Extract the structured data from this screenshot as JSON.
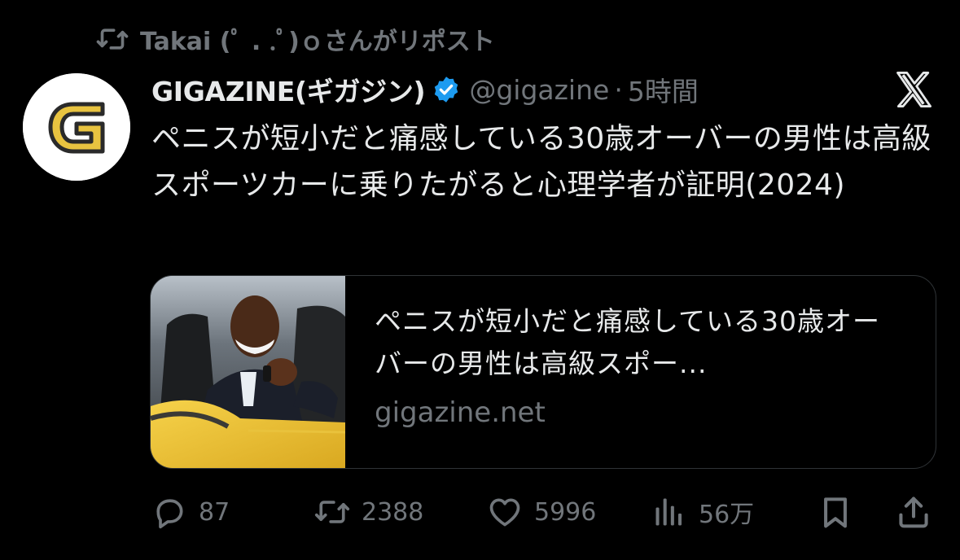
{
  "repost": {
    "text": "Takai (ﾟ . .ﾟ)ｏさんがリポスト"
  },
  "author": {
    "display_name": "GIGAZINE(ギガジン)",
    "handle": "@gigazine",
    "separator": "·",
    "time": "5時間",
    "avatar_letter": "G"
  },
  "tweet": {
    "text": "ペニスが短小だと痛感している30歳オーバーの男性は高級スポーツカーに乗りたがると心理学者が証明(2024)"
  },
  "card": {
    "title": "ペニスが短小だと痛感している30歳オーバーの男性は高級スポー...",
    "domain": "gigazine.net"
  },
  "actions": {
    "replies": "87",
    "reposts": "2388",
    "likes": "5996",
    "views": "56万"
  },
  "colors": {
    "background": "#000000",
    "primary_text": "#e7e9ea",
    "secondary_text": "#71767b",
    "verified_badge": "#1d9bf0",
    "border": "#2f3336",
    "avatar_logo": "#e8c340"
  },
  "icons": {
    "repost": "repost-icon",
    "verified": "verified-badge-icon",
    "platform": "x-logo-icon",
    "reply": "reply-icon",
    "retweet": "retweet-icon",
    "like": "heart-icon",
    "views": "views-icon",
    "bookmark": "bookmark-icon",
    "share": "share-icon"
  }
}
